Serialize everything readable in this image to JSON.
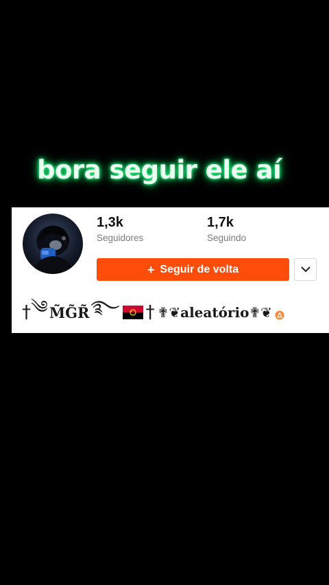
{
  "caption": "bora seguir ele aí",
  "profile": {
    "followers_count": "1,3k",
    "followers_label": "Seguidores",
    "following_count": "1,7k",
    "following_label": "Seguindo",
    "follow_back_label": "Seguir de volta",
    "bio_name": "M̃G̃R̃",
    "bio_word": "aleatório"
  },
  "icons": {
    "avatar": "profile-avatar-image",
    "plus": "plus-icon",
    "dropdown": "chevron-down-icon",
    "flag": "angola-flag-icon",
    "badge": "creator-badge-icon"
  },
  "colors": {
    "caption_glow": "#2cff8a",
    "follow_button": "#fe4c0a",
    "card_background": "#ffffff",
    "page_background": "#000000"
  }
}
